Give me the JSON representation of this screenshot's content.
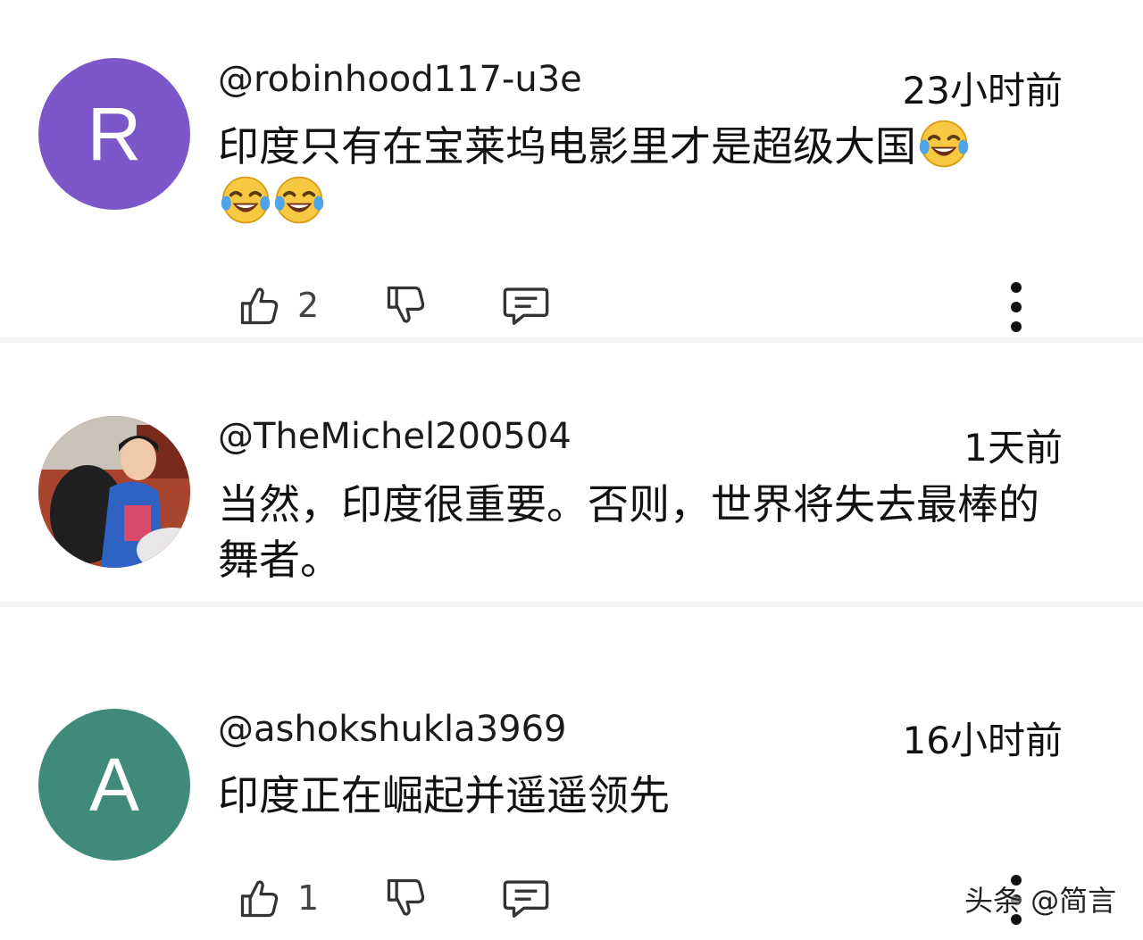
{
  "comments": [
    {
      "avatar_letter": "R",
      "avatar_color": "#7b57c9",
      "username": "@robinhood117-u3e",
      "time": "23小时前",
      "text": "印度只有在宝莱坞电影里才是超级大国",
      "emojis": [
        "face-with-tears-of-joy",
        "face-with-tears-of-joy",
        "face-with-tears-of-joy"
      ],
      "like_count": "2"
    },
    {
      "avatar_letter": "",
      "avatar_color": "#b0553f",
      "username": "@TheMichel200504",
      "time": "1天前",
      "text": "当然，印度很重要。否则，世界将失去最棒的舞者。"
    },
    {
      "avatar_letter": "A",
      "avatar_color": "#3f8a78",
      "username": "@ashokshukla3969",
      "time": "16小时前",
      "text": "印度正在崛起并遥遥领先",
      "like_count": "1"
    }
  ],
  "watermark": "头条 @简言",
  "icons": {
    "like": "thumbs-up-icon",
    "dislike": "thumbs-down-icon",
    "reply": "reply-icon",
    "more": "more-vertical-icon"
  }
}
